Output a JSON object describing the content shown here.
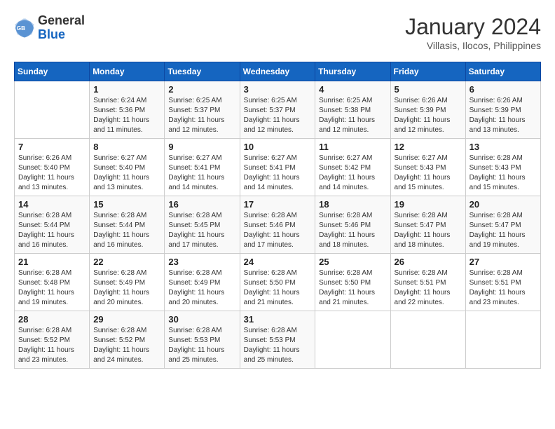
{
  "logo": {
    "line1": "General",
    "line2": "Blue"
  },
  "title": "January 2024",
  "subtitle": "Villasis, Ilocos, Philippines",
  "days_header": [
    "Sunday",
    "Monday",
    "Tuesday",
    "Wednesday",
    "Thursday",
    "Friday",
    "Saturday"
  ],
  "weeks": [
    [
      {
        "day": "",
        "sunrise": "",
        "sunset": "",
        "daylight": ""
      },
      {
        "day": "1",
        "sunrise": "Sunrise: 6:24 AM",
        "sunset": "Sunset: 5:36 PM",
        "daylight": "Daylight: 11 hours and 11 minutes."
      },
      {
        "day": "2",
        "sunrise": "Sunrise: 6:25 AM",
        "sunset": "Sunset: 5:37 PM",
        "daylight": "Daylight: 11 hours and 12 minutes."
      },
      {
        "day": "3",
        "sunrise": "Sunrise: 6:25 AM",
        "sunset": "Sunset: 5:37 PM",
        "daylight": "Daylight: 11 hours and 12 minutes."
      },
      {
        "day": "4",
        "sunrise": "Sunrise: 6:25 AM",
        "sunset": "Sunset: 5:38 PM",
        "daylight": "Daylight: 11 hours and 12 minutes."
      },
      {
        "day": "5",
        "sunrise": "Sunrise: 6:26 AM",
        "sunset": "Sunset: 5:39 PM",
        "daylight": "Daylight: 11 hours and 12 minutes."
      },
      {
        "day": "6",
        "sunrise": "Sunrise: 6:26 AM",
        "sunset": "Sunset: 5:39 PM",
        "daylight": "Daylight: 11 hours and 13 minutes."
      }
    ],
    [
      {
        "day": "7",
        "sunrise": "Sunrise: 6:26 AM",
        "sunset": "Sunset: 5:40 PM",
        "daylight": "Daylight: 11 hours and 13 minutes."
      },
      {
        "day": "8",
        "sunrise": "Sunrise: 6:27 AM",
        "sunset": "Sunset: 5:40 PM",
        "daylight": "Daylight: 11 hours and 13 minutes."
      },
      {
        "day": "9",
        "sunrise": "Sunrise: 6:27 AM",
        "sunset": "Sunset: 5:41 PM",
        "daylight": "Daylight: 11 hours and 14 minutes."
      },
      {
        "day": "10",
        "sunrise": "Sunrise: 6:27 AM",
        "sunset": "Sunset: 5:41 PM",
        "daylight": "Daylight: 11 hours and 14 minutes."
      },
      {
        "day": "11",
        "sunrise": "Sunrise: 6:27 AM",
        "sunset": "Sunset: 5:42 PM",
        "daylight": "Daylight: 11 hours and 14 minutes."
      },
      {
        "day": "12",
        "sunrise": "Sunrise: 6:27 AM",
        "sunset": "Sunset: 5:43 PM",
        "daylight": "Daylight: 11 hours and 15 minutes."
      },
      {
        "day": "13",
        "sunrise": "Sunrise: 6:28 AM",
        "sunset": "Sunset: 5:43 PM",
        "daylight": "Daylight: 11 hours and 15 minutes."
      }
    ],
    [
      {
        "day": "14",
        "sunrise": "Sunrise: 6:28 AM",
        "sunset": "Sunset: 5:44 PM",
        "daylight": "Daylight: 11 hours and 16 minutes."
      },
      {
        "day": "15",
        "sunrise": "Sunrise: 6:28 AM",
        "sunset": "Sunset: 5:44 PM",
        "daylight": "Daylight: 11 hours and 16 minutes."
      },
      {
        "day": "16",
        "sunrise": "Sunrise: 6:28 AM",
        "sunset": "Sunset: 5:45 PM",
        "daylight": "Daylight: 11 hours and 17 minutes."
      },
      {
        "day": "17",
        "sunrise": "Sunrise: 6:28 AM",
        "sunset": "Sunset: 5:46 PM",
        "daylight": "Daylight: 11 hours and 17 minutes."
      },
      {
        "day": "18",
        "sunrise": "Sunrise: 6:28 AM",
        "sunset": "Sunset: 5:46 PM",
        "daylight": "Daylight: 11 hours and 18 minutes."
      },
      {
        "day": "19",
        "sunrise": "Sunrise: 6:28 AM",
        "sunset": "Sunset: 5:47 PM",
        "daylight": "Daylight: 11 hours and 18 minutes."
      },
      {
        "day": "20",
        "sunrise": "Sunrise: 6:28 AM",
        "sunset": "Sunset: 5:47 PM",
        "daylight": "Daylight: 11 hours and 19 minutes."
      }
    ],
    [
      {
        "day": "21",
        "sunrise": "Sunrise: 6:28 AM",
        "sunset": "Sunset: 5:48 PM",
        "daylight": "Daylight: 11 hours and 19 minutes."
      },
      {
        "day": "22",
        "sunrise": "Sunrise: 6:28 AM",
        "sunset": "Sunset: 5:49 PM",
        "daylight": "Daylight: 11 hours and 20 minutes."
      },
      {
        "day": "23",
        "sunrise": "Sunrise: 6:28 AM",
        "sunset": "Sunset: 5:49 PM",
        "daylight": "Daylight: 11 hours and 20 minutes."
      },
      {
        "day": "24",
        "sunrise": "Sunrise: 6:28 AM",
        "sunset": "Sunset: 5:50 PM",
        "daylight": "Daylight: 11 hours and 21 minutes."
      },
      {
        "day": "25",
        "sunrise": "Sunrise: 6:28 AM",
        "sunset": "Sunset: 5:50 PM",
        "daylight": "Daylight: 11 hours and 21 minutes."
      },
      {
        "day": "26",
        "sunrise": "Sunrise: 6:28 AM",
        "sunset": "Sunset: 5:51 PM",
        "daylight": "Daylight: 11 hours and 22 minutes."
      },
      {
        "day": "27",
        "sunrise": "Sunrise: 6:28 AM",
        "sunset": "Sunset: 5:51 PM",
        "daylight": "Daylight: 11 hours and 23 minutes."
      }
    ],
    [
      {
        "day": "28",
        "sunrise": "Sunrise: 6:28 AM",
        "sunset": "Sunset: 5:52 PM",
        "daylight": "Daylight: 11 hours and 23 minutes."
      },
      {
        "day": "29",
        "sunrise": "Sunrise: 6:28 AM",
        "sunset": "Sunset: 5:52 PM",
        "daylight": "Daylight: 11 hours and 24 minutes."
      },
      {
        "day": "30",
        "sunrise": "Sunrise: 6:28 AM",
        "sunset": "Sunset: 5:53 PM",
        "daylight": "Daylight: 11 hours and 25 minutes."
      },
      {
        "day": "31",
        "sunrise": "Sunrise: 6:28 AM",
        "sunset": "Sunset: 5:53 PM",
        "daylight": "Daylight: 11 hours and 25 minutes."
      },
      {
        "day": "",
        "sunrise": "",
        "sunset": "",
        "daylight": ""
      },
      {
        "day": "",
        "sunrise": "",
        "sunset": "",
        "daylight": ""
      },
      {
        "day": "",
        "sunrise": "",
        "sunset": "",
        "daylight": ""
      }
    ]
  ]
}
